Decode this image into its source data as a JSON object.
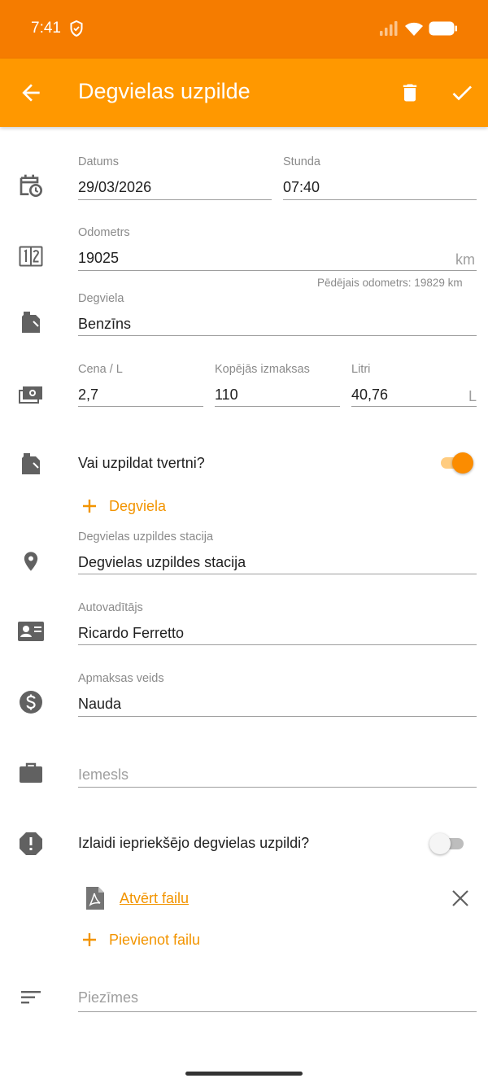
{
  "status_bar": {
    "time": "7:41"
  },
  "app_bar": {
    "title": "Degvielas uzpilde"
  },
  "form": {
    "date": {
      "label": "Datums",
      "value": "29/03/2026"
    },
    "hour": {
      "label": "Stunda",
      "value": "07:40"
    },
    "odometer": {
      "label": "Odometrs",
      "value": "19025",
      "unit": "km",
      "hint": "Pēdējais odometrs: 19829 km"
    },
    "fuel": {
      "label": "Degviela",
      "value": "Benzīns"
    },
    "price": {
      "label": "Cena / L",
      "value": "2,7"
    },
    "total": {
      "label": "Kopējās izmaksas",
      "value": "110"
    },
    "liters": {
      "label": "Litri",
      "value": "40,76",
      "unit": "L"
    },
    "full_tank": {
      "label": "Vai uzpildat tvertni?",
      "enabled": true
    },
    "add_fuel": {
      "label": "Degviela"
    },
    "station": {
      "label": "Degvielas uzpildes stacija",
      "value": "Degvielas uzpildes stacija"
    },
    "driver": {
      "label": "Autovadītājs",
      "value": "Ricardo Ferretto"
    },
    "payment": {
      "label": "Apmaksas veids",
      "value": "Nauda"
    },
    "reason": {
      "placeholder": "Iemesls"
    },
    "missed_previous": {
      "label": "Izlaidi iepriekšējo degvielas uzpildi?",
      "enabled": false
    },
    "attachment": {
      "label": "Atvērt failu"
    },
    "add_file": {
      "label": "Pievienot failu"
    },
    "notes": {
      "placeholder": "Piezīmes"
    }
  },
  "colors": {
    "status_bar": "#F57C00",
    "app_bar": "#FF9800",
    "accent": "#F29400",
    "icon": "#616161"
  }
}
